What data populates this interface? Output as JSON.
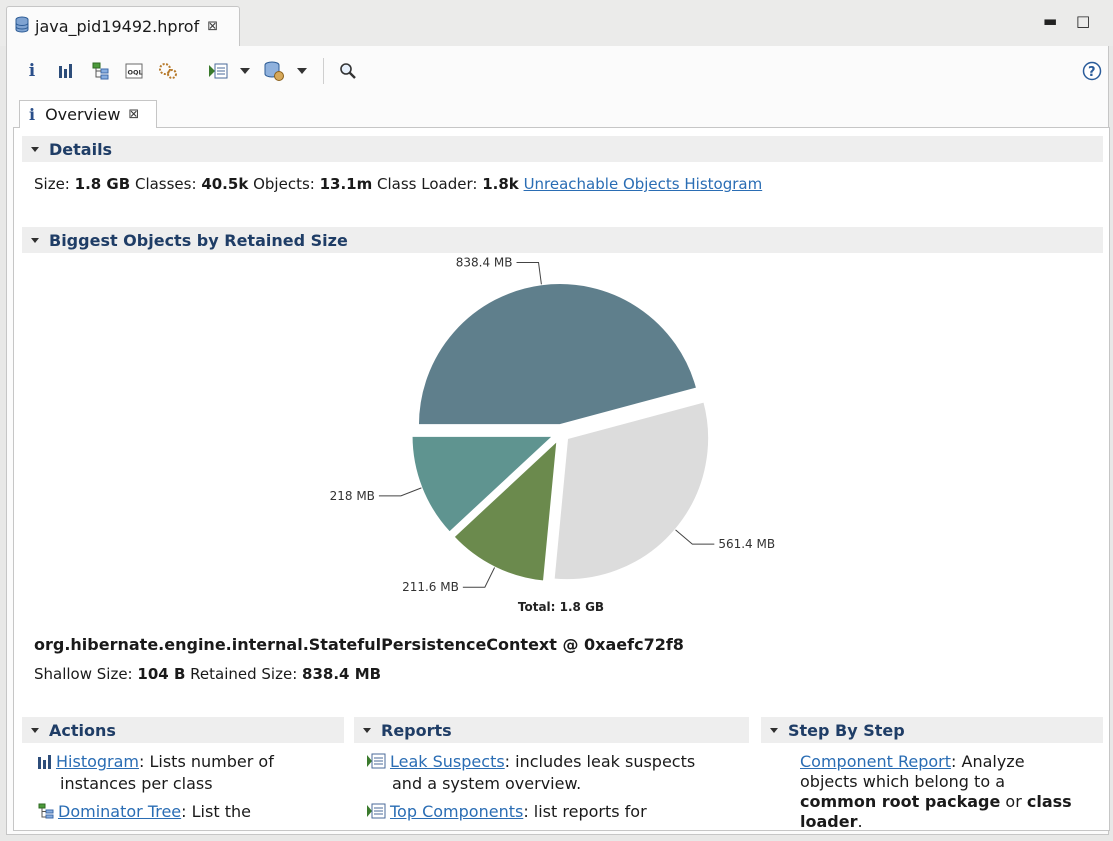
{
  "editor_tab": {
    "title": "java_pid19492.hprof",
    "close_icon": "close-icon"
  },
  "window_controls": {
    "minimize": "▬",
    "maximize": "□"
  },
  "toolbar": {
    "icons": [
      "info-icon",
      "histogram-icon",
      "dominator-tree-icon",
      "oql-icon",
      "thread-overview-icon",
      "run-report-icon",
      "dropdown-icon",
      "query-browser-icon",
      "dropdown-icon",
      "search-icon"
    ],
    "help_icon": "help-icon"
  },
  "inner_tab": {
    "title": "Overview",
    "icon": "info-icon"
  },
  "details": {
    "header": "Details",
    "size_label": "Size:",
    "size_value": "1.8 GB",
    "classes_label": "Classes:",
    "classes_value": "40.5k",
    "objects_label": "Objects:",
    "objects_value": "13.1m",
    "classloader_label": "Class Loader:",
    "classloader_value": "1.8k",
    "link": "Unreachable Objects Histogram"
  },
  "biggest": {
    "header": "Biggest Objects by Retained Size",
    "object_name": "org.hibernate.engine.internal.StatefulPersistenceContext @ 0xaefc72f8",
    "shallow_label": "Shallow Size:",
    "shallow_value": "104 B",
    "retained_label": "Retained Size:",
    "retained_value": "838.4 MB"
  },
  "chart_data": {
    "type": "pie",
    "total_label": "Total: 1.8 GB",
    "slices": [
      {
        "label": "838.4 MB",
        "value": 838.4,
        "color": "#5f7f8c"
      },
      {
        "label": "561.4 MB",
        "value": 561.4,
        "color": "#dcdcdc"
      },
      {
        "label": "211.6 MB",
        "value": 211.6,
        "color": "#6b8a4d"
      },
      {
        "label": "218 MB",
        "value": 218,
        "color": "#5f9490"
      }
    ]
  },
  "actions": {
    "header": "Actions",
    "items": [
      {
        "link": "Histogram",
        "text1": ": Lists number of",
        "text2": "instances per class",
        "icon": "histogram-icon"
      },
      {
        "link": "Dominator Tree",
        "text1": ": List the",
        "text2": "",
        "icon": "dominator-tree-icon"
      }
    ]
  },
  "reports": {
    "header": "Reports",
    "items": [
      {
        "link": "Leak Suspects",
        "text1": ": includes leak suspects",
        "text2": "and a system overview.",
        "icon": "report-icon"
      },
      {
        "link": "Top Components",
        "text1": ": list reports for",
        "text2": "",
        "icon": "report-icon"
      }
    ]
  },
  "stepbystep": {
    "header": "Step By Step",
    "item": {
      "link": "Component Report",
      "text1": ": Analyze",
      "text2": "objects which belong to a",
      "bold1": "common root package",
      "mid": " or ",
      "bold2": "class",
      "bold3": "loader",
      "end": "."
    }
  }
}
